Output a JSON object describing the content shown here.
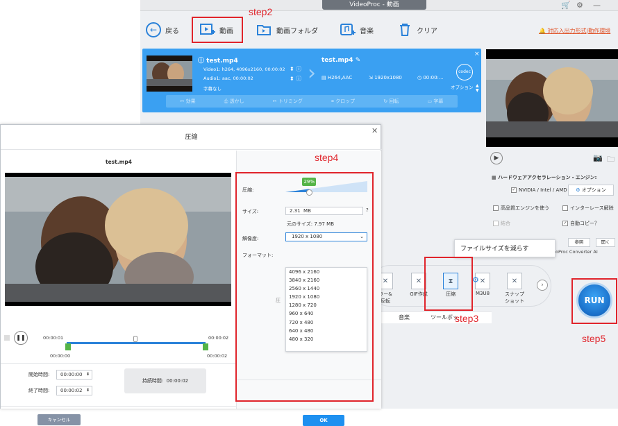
{
  "app": {
    "title": "VideoProc - 動画",
    "toolbar": {
      "back": "戻る",
      "video": "動画",
      "video_folder": "動画フォルダ",
      "music": "音楽",
      "clear": "クリア"
    },
    "notice": "対応入出力形式|動作環境"
  },
  "item": {
    "source_name": "test.mp4",
    "video_info": "Video1: h264, 4096x2160, 00:00:02",
    "audio_info": "Audio1: aac, 00:00:02",
    "subtitle": "字幕なし",
    "output_name": "test.mp4",
    "codec": "H264,AAC",
    "resolution": "1920x1080",
    "duration": "00:00:...",
    "option_label": "オプション",
    "tabs": [
      "効果",
      "透かし",
      "トリミング",
      "クロップ",
      "回転",
      "字幕"
    ]
  },
  "hw": {
    "title": "ハードウェアアクセラレーション・エンジン:",
    "nvidia": "NVIDIA / Intel / AMD",
    "option": "オプション",
    "high_quality": "高品質エンジンを使う",
    "deinterlace": "インターレース解除",
    "merge": "結合",
    "auto_copy": "自動コピー？",
    "browse": "参照",
    "open": "開く",
    "converter_ai": "oProc Converter AI"
  },
  "bottom": {
    "tools": [
      "ラー&\n反転",
      "GIF作成",
      "圧縮",
      "M3U8",
      "スナップ\nショット"
    ],
    "tabs": [
      "音楽",
      "ツールボックス"
    ],
    "run": "RUN",
    "tooltip": "ファイルサイズを減らす"
  },
  "dialog": {
    "title": "圧縮",
    "file_name": "test.mp4",
    "time_start": "00:00:01",
    "time_end": "00:00:02",
    "time_left": "00:00:00",
    "time_right": "00:00:02",
    "start_label": "開始時間:",
    "end_label": "終了時間:",
    "start_value": "00:00:00",
    "end_value": "00:00:02",
    "duration_label": "持続時間:",
    "duration_value": "00:00:02",
    "cancel": "キャンセル",
    "compress_label": "圧縮:",
    "compress_percent": "29%",
    "compress_level": 0.29,
    "size_label": "サイズ:",
    "size_value": "2.31",
    "size_unit": "MB",
    "original_size": "元のサイズ:  7.97 MB",
    "resolution_label": "解像度:",
    "resolution_value": "1920 x 1080",
    "format_label": "フォーマット:",
    "options": [
      "4096 x 2160",
      "3840 x 2160",
      "2560 x 1440",
      "1920 x 1080",
      "1280 x 720",
      "960 x 640",
      "720 x 480",
      "640 x 480",
      "480 x 320"
    ],
    "ok": "OK"
  },
  "annotations": {
    "step2": "step2",
    "step3": "step3",
    "step4": "step4",
    "step5": "step5"
  },
  "colors": {
    "accent": "#1e90f0",
    "item_panel": "#3aa0f2",
    "annotation_red": "#e0242b",
    "slider_green": "#55b447"
  }
}
